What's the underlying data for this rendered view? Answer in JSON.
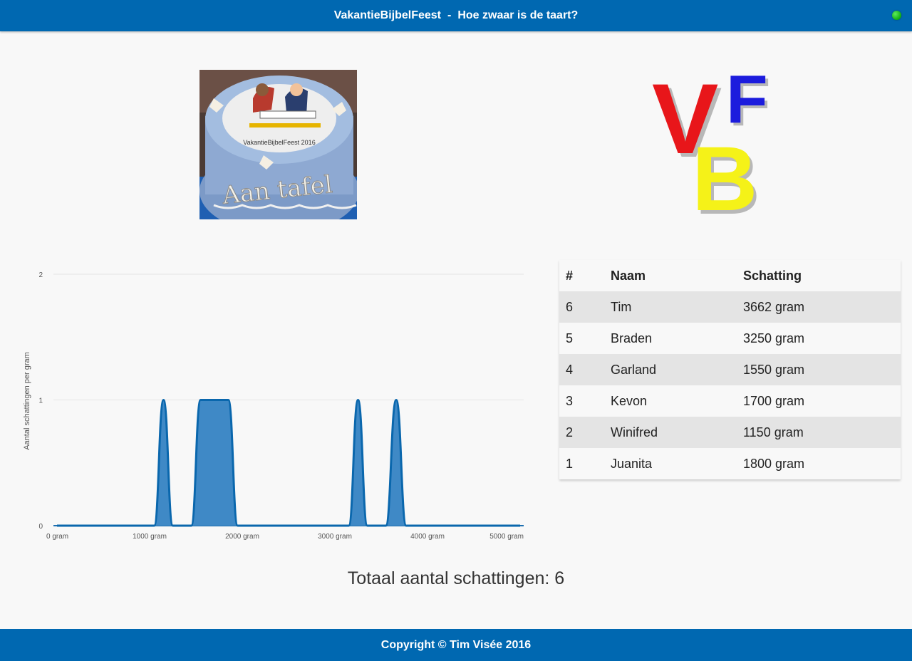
{
  "header": {
    "site_name": "VakantieBijbelFeest",
    "separator": "-",
    "page_title": "Hoe zwaar is de taart?"
  },
  "cake_image": {
    "caption_top": "VakantieBijbelFeest 2016",
    "cake_text": "Aan tafel"
  },
  "logo": {
    "letters": [
      "V",
      "F",
      "B"
    ]
  },
  "chart_data": {
    "type": "area",
    "title": "",
    "xlabel": "",
    "ylabel": "Aantal schattingen per gram",
    "x_ticks": [
      "0 gram",
      "1000 gram",
      "2000 gram",
      "3000 gram",
      "4000 gram",
      "5000 gram"
    ],
    "y_ticks": [
      "0",
      "1",
      "2"
    ],
    "xlim": [
      0,
      5000
    ],
    "ylim": [
      0,
      2
    ],
    "grid": true,
    "estimates": [
      1150,
      1550,
      1700,
      1800,
      3250,
      3662
    ],
    "series": [
      {
        "x": [
          0,
          1050,
          1150,
          1250,
          1450,
          1550,
          1850,
          1950,
          3150,
          3250,
          3350,
          3550,
          3662,
          3770,
          5000
        ],
        "y": [
          0,
          0,
          1,
          0,
          0,
          1,
          1,
          0,
          0,
          1,
          0,
          0,
          1,
          0,
          0
        ]
      }
    ]
  },
  "table": {
    "headers": [
      "#",
      "Naam",
      "Schatting"
    ],
    "rows": [
      {
        "num": "6",
        "name": "Tim",
        "estimate": "3662 gram"
      },
      {
        "num": "5",
        "name": "Braden",
        "estimate": "3250 gram"
      },
      {
        "num": "4",
        "name": "Garland",
        "estimate": "1550 gram"
      },
      {
        "num": "3",
        "name": "Kevon",
        "estimate": "1700 gram"
      },
      {
        "num": "2",
        "name": "Winifred",
        "estimate": "1150 gram"
      },
      {
        "num": "1",
        "name": "Juanita",
        "estimate": "1800 gram"
      }
    ]
  },
  "total": "Totaal aantal schattingen: 6",
  "footer": {
    "copyright": "Copyright © Tim Visée 2016"
  },
  "colors": {
    "brand_blue": "#0068b1",
    "chart_line": "#0a67ad",
    "chart_fill": "#3f89c6",
    "status_online": "#1cc21c"
  }
}
